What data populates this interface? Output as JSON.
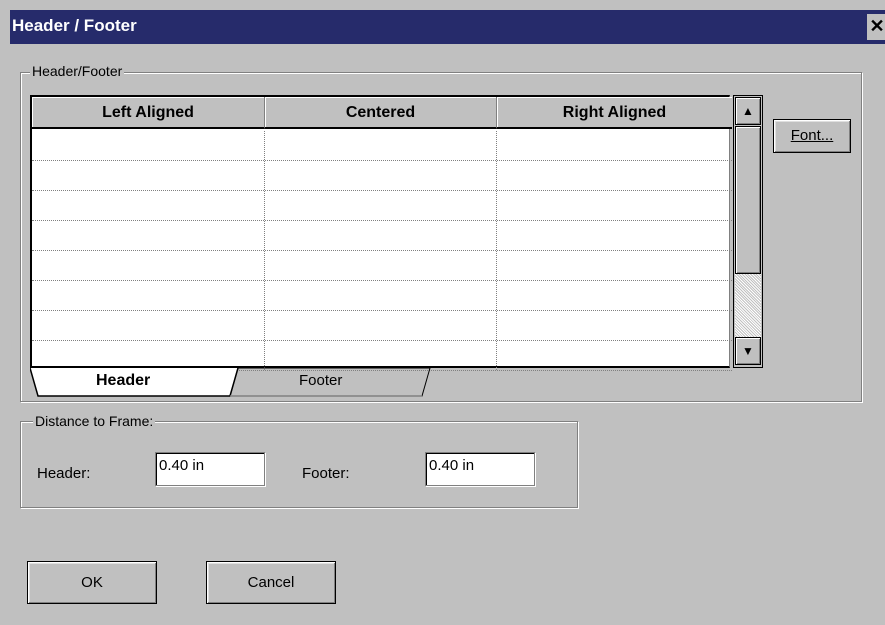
{
  "window": {
    "title": "Header / Footer",
    "close_glyph": "✕"
  },
  "group_header_footer": {
    "label": "Header/Footer",
    "columns": [
      "Left Aligned",
      "Centered",
      "Right Aligned"
    ],
    "rows": [
      [
        "",
        "",
        ""
      ],
      [
        "",
        "",
        ""
      ],
      [
        "",
        "",
        ""
      ],
      [
        "",
        "",
        ""
      ],
      [
        "",
        "",
        ""
      ],
      [
        "",
        "",
        ""
      ],
      [
        "",
        "",
        ""
      ],
      [
        "",
        "",
        ""
      ]
    ],
    "font_button": "Font...",
    "tabs": [
      {
        "label": "Header",
        "selected": true
      },
      {
        "label": "Footer",
        "selected": false
      }
    ],
    "scroll_up_icon": "▲",
    "scroll_down_icon": "▼"
  },
  "group_distance": {
    "label": "Distance to Frame:",
    "header_label": "Header:",
    "header_value": "0.40 in",
    "footer_label": "Footer:",
    "footer_value": "0.40 in"
  },
  "buttons": {
    "ok": "OK",
    "cancel": "Cancel"
  },
  "colors": {
    "titlebar": "#262b6b",
    "dialog_bg": "#c0c0c0"
  }
}
